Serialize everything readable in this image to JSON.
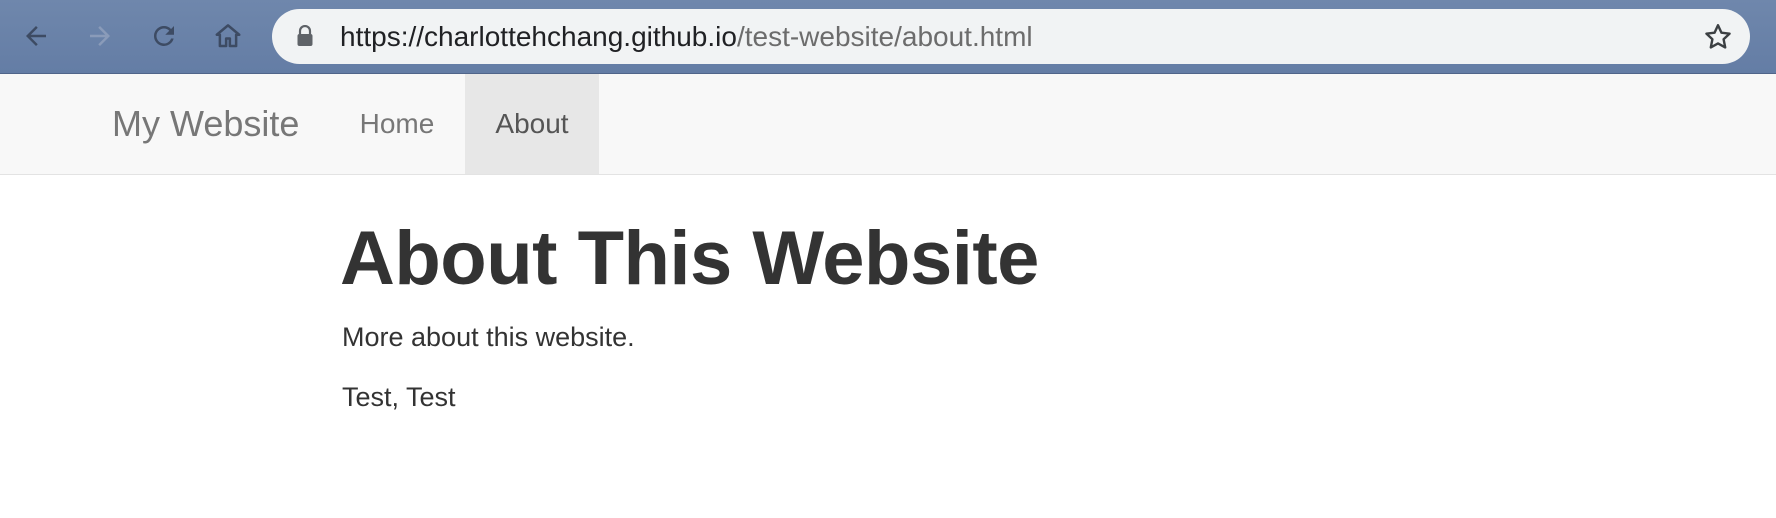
{
  "browser": {
    "url_host": "https://charlottehchang.github.io",
    "url_path": "/test-website/about.html",
    "buttons": [
      "back-icon",
      "forward-icon",
      "reload-icon",
      "home-icon"
    ],
    "omnibox_icons": [
      "lock-icon",
      "bookmark-star-icon"
    ],
    "chrome_color": "#6b82aa"
  },
  "navbar": {
    "brand": "My Website",
    "links": [
      {
        "label": "Home",
        "active": false
      },
      {
        "label": "About",
        "active": true
      }
    ]
  },
  "content": {
    "title": "About This Website",
    "paragraphs": [
      "More about this website.",
      "Test, Test"
    ]
  }
}
